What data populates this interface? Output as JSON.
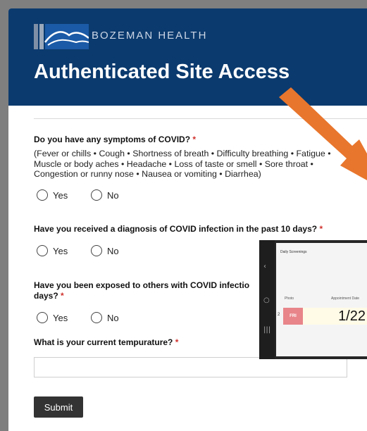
{
  "header": {
    "brand": "BOZEMAN HEALTH",
    "title": "Authenticated Site Access"
  },
  "questions": [
    {
      "label": "Do you have any symptoms of COVID?",
      "required": "*",
      "description": "(Fever or chills • Cough • Shortness of breath • Difficulty breathing • Fatigue • Muscle or body aches • Headache • Loss of taste or smell • Sore throat • Congestion or runny nose • Nausea or vomiting • Diarrhea)",
      "options": [
        "Yes",
        "No"
      ]
    },
    {
      "label": "Have you received a diagnosis of COVID infection in the past 10 days?",
      "required": "*",
      "options": [
        "Yes",
        "No"
      ]
    },
    {
      "label_line1": "Have you been exposed to others with COVID infectio",
      "label_line2": "days?",
      "required": "*",
      "options": [
        "Yes",
        "No"
      ]
    },
    {
      "label": "What is your current tempurature?",
      "required": "*",
      "value": ""
    }
  ],
  "submit_label": "Submit",
  "tablet": {
    "title": "Daily Screenings",
    "col_photo": "Photo",
    "col_date": "Appointment Date",
    "row_num": "2",
    "row_day": "FRI",
    "row_date": "1/22"
  },
  "colors": {
    "header_bg": "#0b3a6e",
    "arrow": "#e8762d",
    "required": "#d0312d",
    "submit_bg": "#333333"
  }
}
